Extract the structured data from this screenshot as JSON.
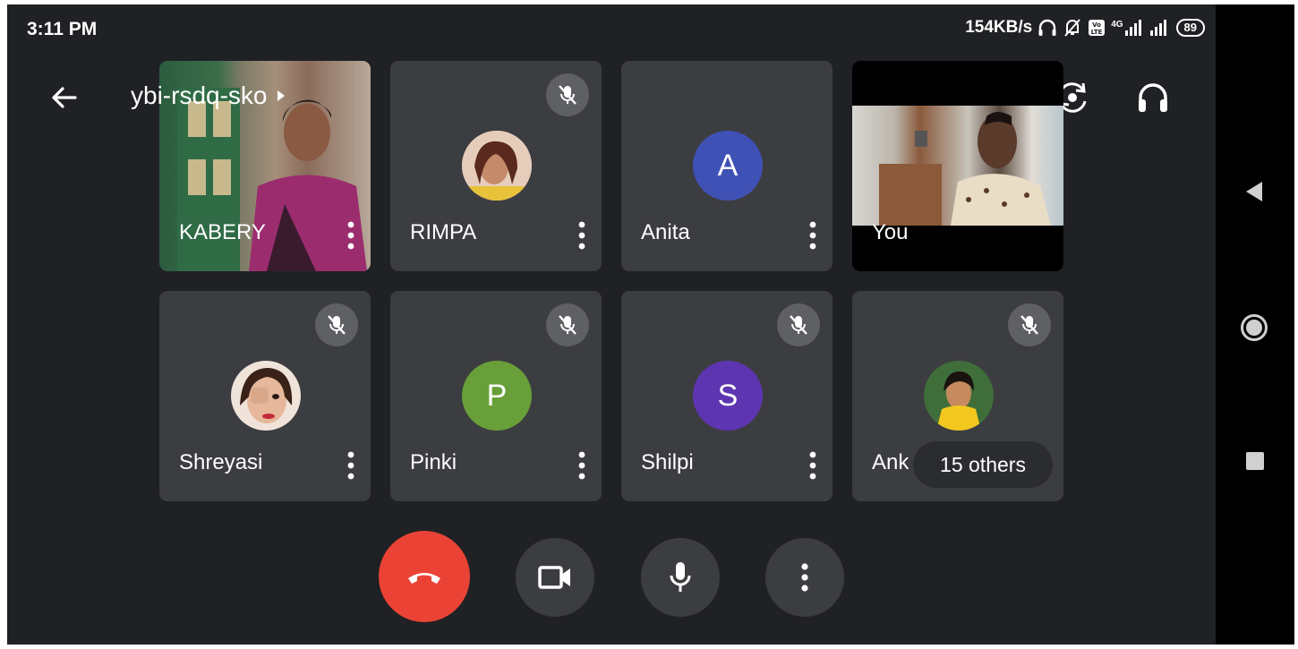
{
  "status_bar": {
    "time": "3:11 PM",
    "network_speed": "154KB/s",
    "network_type": "4G",
    "battery": "89",
    "icons": [
      "headphones-icon",
      "notifications-off-icon",
      "volte-icon",
      "signal-icon",
      "signal-icon",
      "battery-icon"
    ]
  },
  "meeting": {
    "code": "ybi-rsdq-sko",
    "code_icon": "caret-right-icon"
  },
  "toolbar": {
    "back_icon": "arrow-left-icon",
    "flip_icon": "flip-camera-icon",
    "audio_icon": "headphones-icon"
  },
  "participants": [
    {
      "name": "KABERY",
      "type": "video",
      "muted": false
    },
    {
      "name": "RIMPA",
      "type": "photo",
      "muted": true
    },
    {
      "name": "Anita",
      "type": "initial",
      "initial": "A",
      "color": "#3f51b5",
      "muted": false
    },
    {
      "name": "You",
      "type": "video",
      "muted": false
    },
    {
      "name": "Shreyasi",
      "type": "photo",
      "muted": true
    },
    {
      "name": "Pinki",
      "type": "initial",
      "initial": "P",
      "color": "#689f38",
      "muted": true
    },
    {
      "name": "Shilpi",
      "type": "initial",
      "initial": "S",
      "color": "#5e35b1",
      "muted": true
    },
    {
      "name": "Ank",
      "type": "photo",
      "muted": true
    }
  ],
  "others_label": "15 others",
  "controls": {
    "hangup_color": "#ea4335",
    "icons": [
      "end-call-icon",
      "camera-icon",
      "microphone-icon",
      "more-vert-icon"
    ]
  },
  "nav_bar": {
    "icons": [
      "nav-back-icon",
      "nav-home-icon",
      "nav-recent-icon"
    ]
  }
}
